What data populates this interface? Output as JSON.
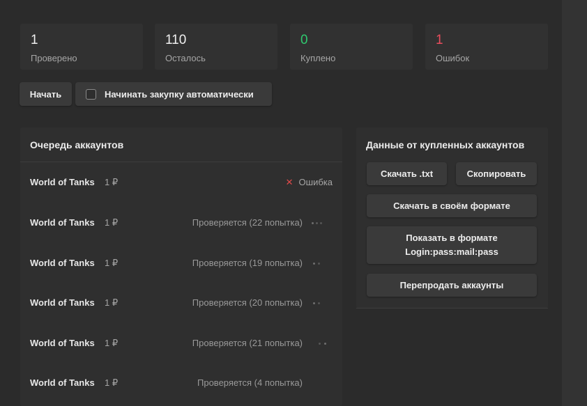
{
  "stats": [
    {
      "value": "1",
      "label": "Проверено",
      "color": "#f0f0f0"
    },
    {
      "value": "110",
      "label": "Осталось",
      "color": "#f0f0f0"
    },
    {
      "value": "0",
      "label": "Куплено",
      "color": "#2fc96f"
    },
    {
      "value": "1",
      "label": "Ошибок",
      "color": "#ea4d5d"
    }
  ],
  "controls": {
    "start_label": "Начать",
    "auto_buy_label": "Начинать закупку автоматически",
    "auto_buy_checked": false
  },
  "queue": {
    "title": "Очередь аккаунтов",
    "rows": [
      {
        "game": "World of Tanks",
        "price": "1 ₽",
        "status": "Ошибка",
        "state": "error"
      },
      {
        "game": "World of Tanks",
        "price": "1 ₽",
        "status": "Проверяется (22 попытка)",
        "state": "checking"
      },
      {
        "game": "World of Tanks",
        "price": "1 ₽",
        "status": "Проверяется (19 попытка)",
        "state": "checking"
      },
      {
        "game": "World of Tanks",
        "price": "1 ₽",
        "status": "Проверяется (20 попытка)",
        "state": "checking"
      },
      {
        "game": "World of Tanks",
        "price": "1 ₽",
        "status": "Проверяется (21 попытка)",
        "state": "checking"
      },
      {
        "game": "World of Tanks",
        "price": "1 ₽",
        "status": "Проверяется (4 попытка)",
        "state": "checking"
      }
    ]
  },
  "bought": {
    "title": "Данные от купленных аккаунтов",
    "download_txt": "Скачать .txt",
    "copy": "Скопировать",
    "download_custom": "Скачать в своём формате",
    "show_format_line1": "Показать в формате",
    "show_format_line2": "Login:pass:mail:pass",
    "resell": "Перепродать аккаунты"
  },
  "icons": {
    "error": "close-icon",
    "checking": "loading-spinner-icon"
  }
}
